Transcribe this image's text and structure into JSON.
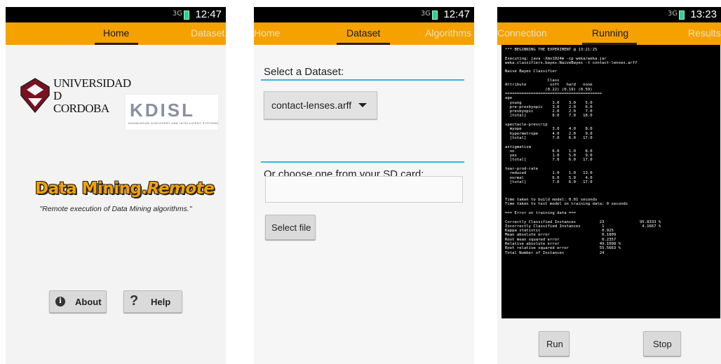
{
  "phone1": {
    "status_time": "12:47",
    "signal": "3G",
    "tabs": [
      "Home",
      "Dataset"
    ],
    "uco_logo_text": [
      "UNIVERSIDAD",
      "D",
      "CORDOBA"
    ],
    "kdis_logo": "KDISL",
    "kdis_subtitle": "KNOWLEDGE DISCOVERY AND INTELLIGENT SYSTEMS",
    "app_logo_main": "Data Mining.",
    "app_logo_italic": "Remote",
    "tagline": "\"Remote execution of Data Mining algorithms.\"",
    "about_label": "About",
    "help_label": "Help",
    "accent_color": "#f5a100"
  },
  "phone2": {
    "status_time": "12:47",
    "signal": "3G",
    "tabs": [
      "Home",
      "Dataset",
      "Algorithms"
    ],
    "select_label": "Select a Dataset:",
    "dataset_value": "contact-lenses.arff",
    "sd_label": "Or choose one from your SD card:",
    "sd_input_value": "",
    "select_file_label": "Select file",
    "line_color": "#33b5e5"
  },
  "phone3": {
    "status_time": "13:23",
    "signal": "3G",
    "tabs": [
      "Connection",
      "Running",
      "Results"
    ],
    "console_text": "*** BEGINNING THE EXPERIMENT @ 13:21:25\n\nExecuting: java -Xmx1024m -cp weka/weka.jar\nweka.classifiers.bayes.NaiveBayes -t contact-lenses.arff\n\nNaive Bayes Classifier\n\n                  Class\nAttribute          soft   hard   none\n                 (0.22) (0.19) (0.59)\n=========================================\nage\n  young             3.0    3.0    5.0\n  pre-presbyopic    3.0    2.0    6.0\n  presbyopic        2.0    2.0    7.0\n  [total]           8.0    7.0   18.0\n\nspectacle-prescrip\n  myope             3.0    4.0    8.0\n  hypermetrope      4.0    2.0    9.0\n  [total]           7.0    6.0   17.0\n\nastigmatism\n  no                6.0    1.0    8.0\n  yes               1.0    5.0    9.0\n  [total]           7.0    6.0   17.0\n\ntear-prod-rate\n  reduced           1.0    1.0   13.0\n  normal            6.0    5.0    4.0\n  [total]           7.0    6.0   17.0\n\n\n\nTime taken to build model: 0.01 seconds\nTime taken to test model on training data: 0 seconds\n\n=== Error on training data ===\n\nCorrectly Classified Instances          23               95.8333 %\nIncorrectly Classified Instances         1                4.1667 %\nKappa statistic                          0.925\nMean absolute error                      0.1809\nRoot mean squared error                  0.2357\nRelative absolute error                 49.1098 %\nRoot relative squared error             55.5663 %\nTotal Number of Instances               24",
    "run_label": "Run",
    "stop_label": "Stop"
  }
}
